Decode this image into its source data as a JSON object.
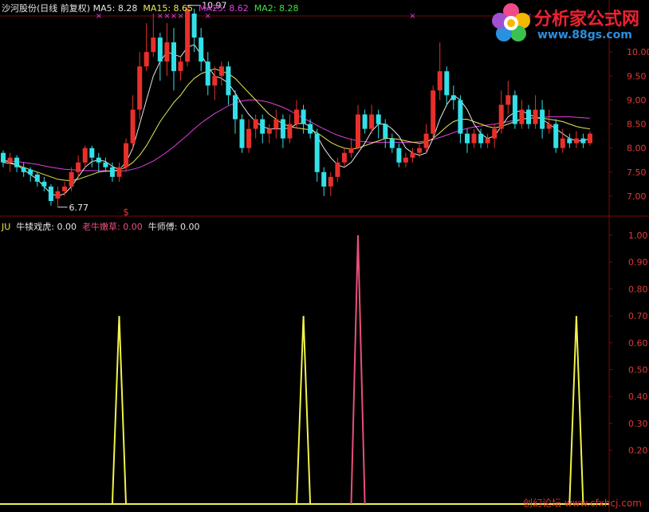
{
  "header": {
    "stock_title": "沙河股份(日线 前复权)",
    "ma5_label": "MA5:",
    "ma5_value": "8.28",
    "ma15_label": "MA15:",
    "ma15_value": "8.65",
    "ma25_label": "MA25:",
    "ma25_value": "8.62",
    "ma2_label": "MA2:",
    "ma2_value": "8.28"
  },
  "indicator_header": {
    "name": "JU",
    "s1_label": "牛犊戏虎:",
    "s1_value": "0.00",
    "s2_label": "老牛嫩草:",
    "s2_value": "0.00",
    "s3_label": "牛师傅:",
    "s3_value": "0.00"
  },
  "logo": {
    "title": "分析家公式网",
    "url": "www.88gs.com"
  },
  "watermark": "创幻论坛 www.cfxhcj.com",
  "colors": {
    "up": "#e8302a",
    "down": "#33e0e8",
    "ma5": "#e6e6e6",
    "ma15": "#e8e85a",
    "ma25": "#e040e0",
    "grid": "#7a0a0a",
    "s1": "#f2f24a",
    "s2": "#e8507a"
  },
  "chart_data": [
    {
      "type": "candlestick",
      "y_ticks": [
        "10.00",
        "9.50",
        "9.00",
        "8.50",
        "8.00",
        "7.50",
        "7.00"
      ],
      "ylim": [
        6.6,
        10.75
      ],
      "annotations": {
        "high": "10.97",
        "low": "6.77",
        "signal": "$"
      },
      "series_names": [
        "MA5",
        "MA15",
        "MA25"
      ],
      "candles": [
        [
          7.9,
          7.7,
          7.95,
          7.6
        ],
        [
          7.7,
          7.8,
          7.9,
          7.5
        ],
        [
          7.8,
          7.6,
          7.85,
          7.5
        ],
        [
          7.6,
          7.5,
          7.7,
          7.4
        ],
        [
          7.55,
          7.45,
          7.6,
          7.3
        ],
        [
          7.45,
          7.3,
          7.5,
          7.2
        ],
        [
          7.3,
          7.2,
          7.4,
          7.1
        ],
        [
          7.2,
          6.9,
          7.25,
          6.8
        ],
        [
          6.95,
          7.1,
          7.2,
          6.77
        ],
        [
          7.1,
          7.2,
          7.3,
          7.0
        ],
        [
          7.2,
          7.5,
          7.6,
          7.1
        ],
        [
          7.5,
          7.7,
          7.85,
          7.4
        ],
        [
          7.7,
          8.0,
          8.05,
          7.6
        ],
        [
          8.0,
          7.8,
          8.05,
          7.6
        ],
        [
          7.8,
          7.7,
          7.9,
          7.5
        ],
        [
          7.7,
          7.6,
          7.8,
          7.5
        ],
        [
          7.6,
          7.4,
          7.7,
          7.3
        ],
        [
          7.4,
          7.6,
          7.7,
          7.3
        ],
        [
          7.6,
          8.1,
          8.2,
          7.5
        ],
        [
          8.1,
          8.8,
          9.1,
          8.0
        ],
        [
          8.8,
          9.7,
          10.0,
          8.6
        ],
        [
          9.7,
          10.0,
          10.6,
          9.6
        ],
        [
          10.0,
          10.3,
          10.8,
          9.9
        ],
        [
          10.3,
          9.8,
          10.4,
          9.4
        ],
        [
          9.8,
          10.2,
          10.6,
          9.5
        ],
        [
          10.2,
          9.6,
          10.5,
          9.2
        ],
        [
          9.6,
          9.8,
          9.9,
          9.4
        ],
        [
          9.8,
          10.9,
          10.97,
          9.7
        ],
        [
          10.8,
          10.3,
          10.9,
          10.0
        ],
        [
          10.3,
          9.8,
          10.5,
          9.6
        ],
        [
          9.8,
          9.3,
          10.0,
          9.1
        ],
        [
          9.3,
          9.5,
          9.7,
          9.0
        ],
        [
          9.5,
          9.7,
          9.8,
          9.3
        ],
        [
          9.7,
          9.1,
          9.8,
          8.9
        ],
        [
          9.1,
          8.6,
          9.2,
          8.3
        ],
        [
          8.6,
          8.0,
          8.7,
          7.9
        ],
        [
          8.0,
          8.4,
          8.6,
          7.9
        ],
        [
          8.4,
          8.6,
          8.7,
          8.2
        ],
        [
          8.6,
          8.3,
          8.7,
          8.1
        ],
        [
          8.3,
          8.4,
          8.5,
          8.1
        ],
        [
          8.4,
          8.6,
          8.8,
          8.2
        ],
        [
          8.6,
          8.2,
          8.7,
          8.0
        ],
        [
          8.2,
          8.5,
          8.7,
          8.1
        ],
        [
          8.5,
          8.8,
          9.0,
          8.4
        ],
        [
          8.8,
          8.5,
          8.9,
          8.3
        ],
        [
          8.5,
          8.3,
          8.6,
          8.2
        ],
        [
          8.3,
          7.5,
          8.4,
          7.3
        ],
        [
          7.5,
          7.2,
          7.6,
          7.0
        ],
        [
          7.2,
          7.4,
          7.5,
          7.0
        ],
        [
          7.4,
          7.7,
          7.8,
          7.3
        ],
        [
          7.7,
          7.9,
          8.0,
          7.6
        ],
        [
          7.9,
          8.0,
          8.2,
          7.8
        ],
        [
          8.0,
          8.7,
          8.9,
          8.0
        ],
        [
          8.7,
          8.4,
          8.8,
          8.3
        ],
        [
          8.4,
          8.7,
          8.9,
          8.3
        ],
        [
          8.7,
          8.5,
          8.8,
          8.2
        ],
        [
          8.5,
          8.2,
          8.6,
          8.0
        ],
        [
          8.2,
          8.0,
          8.3,
          7.9
        ],
        [
          8.0,
          7.7,
          8.1,
          7.6
        ],
        [
          7.7,
          7.8,
          7.9,
          7.6
        ],
        [
          7.8,
          7.9,
          8.0,
          7.7
        ],
        [
          7.9,
          8.0,
          8.1,
          7.8
        ],
        [
          8.0,
          8.3,
          8.5,
          7.9
        ],
        [
          8.3,
          9.2,
          9.3,
          8.2
        ],
        [
          9.2,
          9.6,
          10.2,
          9.0
        ],
        [
          9.6,
          9.1,
          9.7,
          8.9
        ],
        [
          9.1,
          9.0,
          9.3,
          8.8
        ],
        [
          9.0,
          8.3,
          9.1,
          8.1
        ],
        [
          8.3,
          8.1,
          8.4,
          7.9
        ],
        [
          8.1,
          8.3,
          8.4,
          8.0
        ],
        [
          8.3,
          8.1,
          8.4,
          8.0
        ],
        [
          8.1,
          8.2,
          8.3,
          8.0
        ],
        [
          8.2,
          8.4,
          8.5,
          8.0
        ],
        [
          8.4,
          8.9,
          9.2,
          8.3
        ],
        [
          8.9,
          9.1,
          9.4,
          8.7
        ],
        [
          9.1,
          8.5,
          9.2,
          8.4
        ],
        [
          8.5,
          8.8,
          9.0,
          8.4
        ],
        [
          8.8,
          8.5,
          8.9,
          8.4
        ],
        [
          8.5,
          8.8,
          9.1,
          8.4
        ],
        [
          8.8,
          8.4,
          9.0,
          8.2
        ],
        [
          8.4,
          8.5,
          8.8,
          8.3
        ],
        [
          8.5,
          8.0,
          8.6,
          7.9
        ],
        [
          8.0,
          8.2,
          8.4,
          7.9
        ],
        [
          8.2,
          8.1,
          8.3,
          8.0
        ],
        [
          8.1,
          8.2,
          8.35,
          8.0
        ],
        [
          8.2,
          8.1,
          8.3,
          8.0
        ],
        [
          8.1,
          8.3,
          8.35,
          8.05
        ]
      ],
      "ma5": [
        7.75,
        7.7,
        7.65,
        7.55,
        7.45,
        7.35,
        7.2,
        7.05,
        7.0,
        7.05,
        7.2,
        7.4,
        7.6,
        7.72,
        7.75,
        7.72,
        7.62,
        7.55,
        7.7,
        8.0,
        8.5,
        9.0,
        9.5,
        9.8,
        10.0,
        9.95,
        9.9,
        10.1,
        10.15,
        9.95,
        9.7,
        9.5,
        9.45,
        9.35,
        9.15,
        8.9,
        8.7,
        8.55,
        8.45,
        8.4,
        8.4,
        8.4,
        8.42,
        8.5,
        8.52,
        8.45,
        8.25,
        8.0,
        7.8,
        7.65,
        7.6,
        7.7,
        7.9,
        8.1,
        8.35,
        8.5,
        8.5,
        8.4,
        8.25,
        8.0,
        7.9,
        7.85,
        7.9,
        8.2,
        8.6,
        8.9,
        9.1,
        9.0,
        8.8,
        8.5,
        8.3,
        8.2,
        8.25,
        8.45,
        8.65,
        8.75,
        8.78,
        8.7,
        8.65,
        8.6,
        8.5,
        8.4,
        8.3,
        8.2,
        8.15,
        8.15,
        8.2
      ],
      "ma15": [
        7.7,
        7.68,
        7.65,
        7.6,
        7.55,
        7.5,
        7.45,
        7.4,
        7.35,
        7.33,
        7.32,
        7.35,
        7.4,
        7.45,
        7.5,
        7.52,
        7.52,
        7.55,
        7.6,
        7.7,
        7.85,
        8.05,
        8.3,
        8.55,
        8.75,
        8.95,
        9.1,
        9.3,
        9.45,
        9.55,
        9.6,
        9.65,
        9.6,
        9.55,
        9.45,
        9.3,
        9.15,
        9.0,
        8.85,
        8.7,
        8.6,
        8.5,
        8.45,
        8.42,
        8.4,
        8.38,
        8.32,
        8.22,
        8.12,
        8.05,
        8.0,
        7.98,
        8.0,
        8.05,
        8.1,
        8.15,
        8.2,
        8.2,
        8.18,
        8.15,
        8.12,
        8.1,
        8.12,
        8.2,
        8.32,
        8.45,
        8.55,
        8.6,
        8.6,
        8.55,
        8.5,
        8.45,
        8.42,
        8.45,
        8.5,
        8.55,
        8.6,
        8.62,
        8.63,
        8.62,
        8.6,
        8.58,
        8.55,
        8.5,
        8.45,
        8.42,
        8.4
      ],
      "ma25": [
        7.75,
        7.73,
        7.72,
        7.7,
        7.68,
        7.66,
        7.63,
        7.6,
        7.58,
        7.56,
        7.55,
        7.54,
        7.53,
        7.53,
        7.53,
        7.53,
        7.52,
        7.52,
        7.53,
        7.56,
        7.6,
        7.66,
        7.73,
        7.82,
        7.92,
        8.03,
        8.15,
        8.27,
        8.4,
        8.52,
        8.62,
        8.72,
        8.8,
        8.88,
        8.94,
        8.98,
        9.0,
        9.0,
        8.98,
        8.95,
        8.9,
        8.85,
        8.78,
        8.7,
        8.62,
        8.55,
        8.47,
        8.4,
        8.33,
        8.27,
        8.22,
        8.18,
        8.15,
        8.13,
        8.12,
        8.12,
        8.12,
        8.12,
        8.12,
        8.12,
        8.12,
        8.13,
        8.15,
        8.18,
        8.22,
        8.27,
        8.32,
        8.37,
        8.41,
        8.44,
        8.46,
        8.48,
        8.5,
        8.52,
        8.55,
        8.58,
        8.6,
        8.62,
        8.63,
        8.64,
        8.65,
        8.65,
        8.65,
        8.65,
        8.64,
        8.63,
        8.62
      ]
    },
    {
      "type": "line",
      "y_ticks": [
        "1.00",
        "0.90",
        "0.80",
        "0.70",
        "0.60",
        "0.50",
        "0.40",
        "0.30",
        "0.20"
      ],
      "ylim": [
        0,
        1.0
      ],
      "series": [
        {
          "name": "牛犊戏虎",
          "peaks": [
            [
              17,
              0.7
            ],
            [
              44,
              0.7
            ],
            [
              84,
              0.7
            ]
          ]
        },
        {
          "name": "老牛嫩草",
          "peaks": [
            [
              52,
              1.0
            ]
          ]
        }
      ]
    }
  ]
}
